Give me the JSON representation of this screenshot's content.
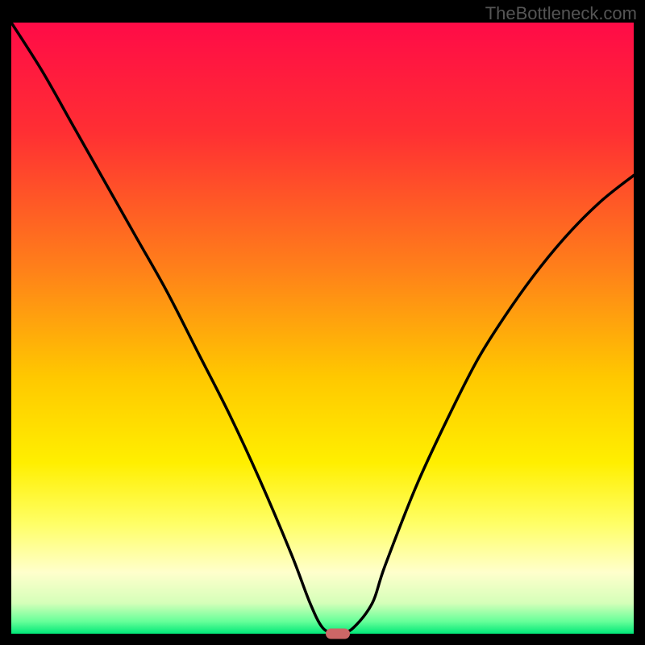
{
  "watermark": "TheBottleneck.com",
  "chart_data": {
    "type": "line",
    "title": "",
    "xlabel": "",
    "ylabel": "",
    "xlim": [
      0,
      100
    ],
    "ylim": [
      0,
      100
    ],
    "gradient_stops": [
      {
        "offset": 0,
        "color": "#ff0b47"
      },
      {
        "offset": 18,
        "color": "#ff2f33"
      },
      {
        "offset": 40,
        "color": "#ff7f1a"
      },
      {
        "offset": 58,
        "color": "#ffc800"
      },
      {
        "offset": 72,
        "color": "#ffef00"
      },
      {
        "offset": 82,
        "color": "#ffff66"
      },
      {
        "offset": 90,
        "color": "#ffffcc"
      },
      {
        "offset": 95,
        "color": "#d5ffb9"
      },
      {
        "offset": 98,
        "color": "#66ff99"
      },
      {
        "offset": 100,
        "color": "#00e878"
      }
    ],
    "series": [
      {
        "name": "bottleneck-curve",
        "x": [
          0,
          5,
          10,
          15,
          20,
          25,
          30,
          35,
          40,
          45,
          48,
          50,
          52,
          53,
          55,
          58,
          60,
          65,
          70,
          75,
          80,
          85,
          90,
          95,
          100
        ],
        "y": [
          100,
          92,
          83,
          74,
          65,
          56,
          46,
          36,
          25,
          13,
          5,
          1,
          0,
          0,
          1,
          5,
          11,
          24,
          35,
          45,
          53,
          60,
          66,
          71,
          75
        ]
      }
    ],
    "marker": {
      "x": 52.5,
      "y": 0,
      "label": "optimal-point"
    }
  }
}
